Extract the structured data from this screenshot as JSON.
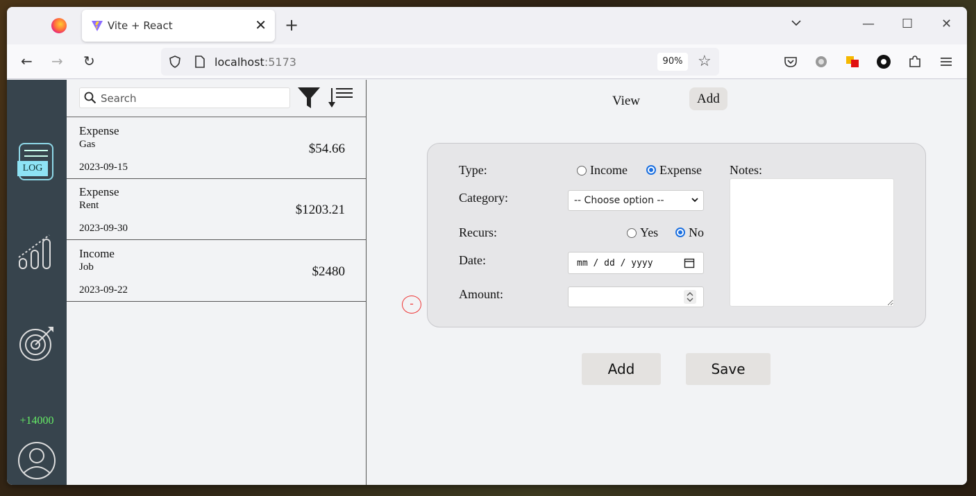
{
  "browser": {
    "tab_title": "Vite + React",
    "url_host": "localhost",
    "url_port": ":5173",
    "zoom": "90%"
  },
  "search": {
    "placeholder": "Search"
  },
  "sidebar": {
    "log_label": "LOG",
    "balance": "+14000"
  },
  "transactions": [
    {
      "type": "Expense",
      "category": "Gas",
      "date": "2023-09-15",
      "amount": "$54.66"
    },
    {
      "type": "Expense",
      "category": "Rent",
      "date": "2023-09-30",
      "amount": "$1203.21"
    },
    {
      "type": "Income",
      "category": "Job",
      "date": "2023-09-22",
      "amount": "$2480"
    }
  ],
  "main": {
    "tabs": {
      "view": "View",
      "add": "Add"
    },
    "remove_label": "-",
    "form": {
      "type_label": "Type:",
      "income_label": "Income",
      "expense_label": "Expense",
      "selected_type": "Expense",
      "category_label": "Category:",
      "category_value": "-- Choose option --",
      "recurs_label": "Recurs:",
      "yes_label": "Yes",
      "no_label": "No",
      "selected_recurs": "No",
      "date_label": "Date:",
      "date_placeholder": "mm / dd / yyyy",
      "amount_label": "Amount:",
      "notes_label": "Notes:"
    },
    "add_button": "Add",
    "save_button": "Save"
  }
}
